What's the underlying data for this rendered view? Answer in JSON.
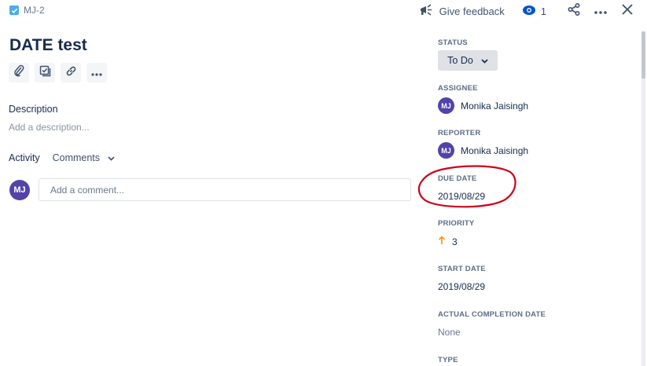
{
  "header": {
    "issue_key": "MJ-2",
    "feedback_label": "Give feedback",
    "watch_count": "1"
  },
  "issue": {
    "title": "DATE test",
    "description_label": "Description",
    "description_placeholder": "Add a description...",
    "activity_label": "Activity",
    "activity_filter": "Comments",
    "comment_avatar": "MJ",
    "comment_placeholder": "Add a comment..."
  },
  "panel": {
    "status": {
      "label": "STATUS",
      "value": "To Do"
    },
    "assignee": {
      "label": "ASSIGNEE",
      "initials": "MJ",
      "name": "Monika Jaisingh"
    },
    "reporter": {
      "label": "REPORTER",
      "initials": "MJ",
      "name": "Monika Jaisingh"
    },
    "due_date": {
      "label": "DUE DATE",
      "value": "2019/08/29"
    },
    "priority": {
      "label": "PRIORITY",
      "value": "3",
      "icon": "arrow-up-icon",
      "icon_color": "#FF991F"
    },
    "start_date": {
      "label": "START DATE",
      "value": "2019/08/29"
    },
    "actual_completion_date": {
      "label": "ACTUAL COMPLETION DATE",
      "value": "None"
    },
    "type": {
      "label": "TYPE"
    }
  },
  "colors": {
    "accent": "#0052CC",
    "avatar": "#5243AA",
    "annotation": "#D0021B",
    "checkbox": "#4BADE8"
  }
}
